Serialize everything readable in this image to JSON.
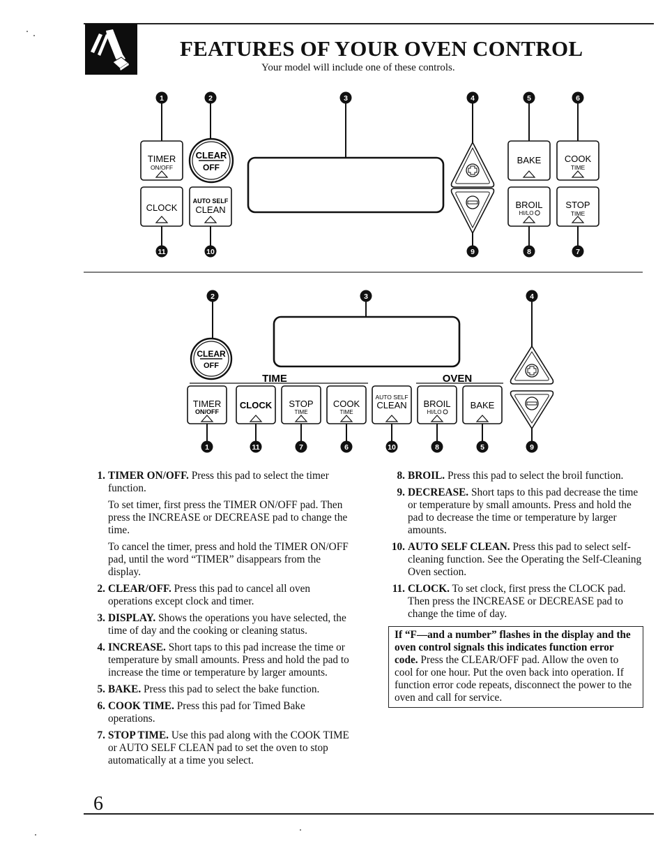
{
  "header": {
    "logo_icon": "finger-pressing-pad-icon",
    "title": "FEATURES OF YOUR OVEN CONTROL",
    "subtitle": "Your model will include one of these controls."
  },
  "colors": {
    "ink": "#111111",
    "callout_fill": "#111111",
    "callout_text": "#ffffff",
    "paper": "#ffffff"
  },
  "control_a": {
    "callouts": [
      "1",
      "2",
      "3",
      "4",
      "5",
      "6",
      "11",
      "10",
      "9",
      "8",
      "7"
    ],
    "pads": {
      "timer": {
        "main": "TIMER",
        "sub": "ON/OFF"
      },
      "clear": {
        "main": "CLEAR",
        "sub": "OFF"
      },
      "clock": {
        "main": "CLOCK"
      },
      "auto_self_clean": {
        "top": "AUTO SELF",
        "main": "CLEAN"
      },
      "bake": {
        "main": "BAKE"
      },
      "cook_time": {
        "main": "COOK",
        "sub": "TIME"
      },
      "broil": {
        "main": "BROIL",
        "sub": "HI/LO"
      },
      "stop_time": {
        "main": "STOP",
        "sub": "TIME"
      },
      "increase_icon": "plus-icon",
      "decrease_icon": "minus-icon"
    }
  },
  "control_b": {
    "callouts_top": [
      "2",
      "3",
      "4"
    ],
    "callouts_bottom": [
      "1",
      "11",
      "7",
      "6",
      "10",
      "8",
      "5",
      "9"
    ],
    "group_time_label": "TIME",
    "group_oven_label": "OVEN",
    "pads": {
      "clear": {
        "main": "CLEAR",
        "sub": "OFF"
      },
      "timer": {
        "main": "TIMER",
        "sub": "ON/OFF"
      },
      "clock": {
        "main": "CLOCK"
      },
      "stop_time": {
        "main": "STOP",
        "sub": "TIME"
      },
      "cook_time": {
        "main": "COOK",
        "sub": "TIME"
      },
      "auto_self_clean": {
        "top": "AUTO SELF",
        "main": "CLEAN"
      },
      "broil": {
        "main": "BROIL",
        "sub": "HI/LO"
      },
      "bake": {
        "main": "BAKE"
      }
    }
  },
  "features_left": [
    {
      "num": "1.",
      "term": "TIMER ON/OFF.",
      "text": " Press this pad to select the timer function.",
      "paras": [
        "To set timer, first press the TIMER ON/OFF pad. Then press the INCREASE or DECREASE pad to change the time.",
        "To cancel the timer, press and hold the TIMER ON/OFF pad, until the word “TIMER” disappears from the display."
      ]
    },
    {
      "num": "2.",
      "term": "CLEAR/OFF.",
      "text": " Press this pad to cancel all oven operations except clock and timer."
    },
    {
      "num": "3.",
      "term": "DISPLAY.",
      "text": " Shows the operations you have selected, the time of day and the cooking or cleaning status."
    },
    {
      "num": "4.",
      "term": "INCREASE.",
      "text": " Short taps to this pad increase the time or temperature by small amounts. Press and hold the pad to increase the time or temperature by larger amounts."
    },
    {
      "num": "5.",
      "term": "BAKE.",
      "text": " Press this pad to select the bake function."
    },
    {
      "num": "6.",
      "term": "COOK TIME.",
      "text": " Press this pad for Timed Bake operations."
    },
    {
      "num": "7.",
      "term": "STOP TIME.",
      "text": " Use this pad along with the COOK TIME or AUTO SELF CLEAN pad to set the oven to stop automatically at a time you select."
    }
  ],
  "features_right": [
    {
      "num": "8.",
      "term": "BROIL.",
      "text": " Press this pad to select the broil function."
    },
    {
      "num": "9.",
      "term": "DECREASE.",
      "text": " Short taps to this pad decrease the time or temperature by small amounts. Press and hold the pad to decrease the time or temperature by larger amounts."
    },
    {
      "num": "10.",
      "term": "AUTO SELF CLEAN.",
      "text": " Press this pad to select self-cleaning function. See the Operating the Self-Cleaning Oven section."
    },
    {
      "num": "11.",
      "term": "CLOCK.",
      "text": " To set clock, first press the CLOCK pad. Then press the INCREASE or DECREASE pad to change the time of day."
    }
  ],
  "notice": {
    "bold": "If “F—and a number” flashes in the display and the oven control signals this indicates function error code.",
    "text": " Press the CLEAR/OFF pad. Allow the oven to cool for one hour. Put the oven back into operation. If function error code repeats, disconnect the power to the oven and call for service."
  },
  "footer": {
    "page_number": "6"
  }
}
